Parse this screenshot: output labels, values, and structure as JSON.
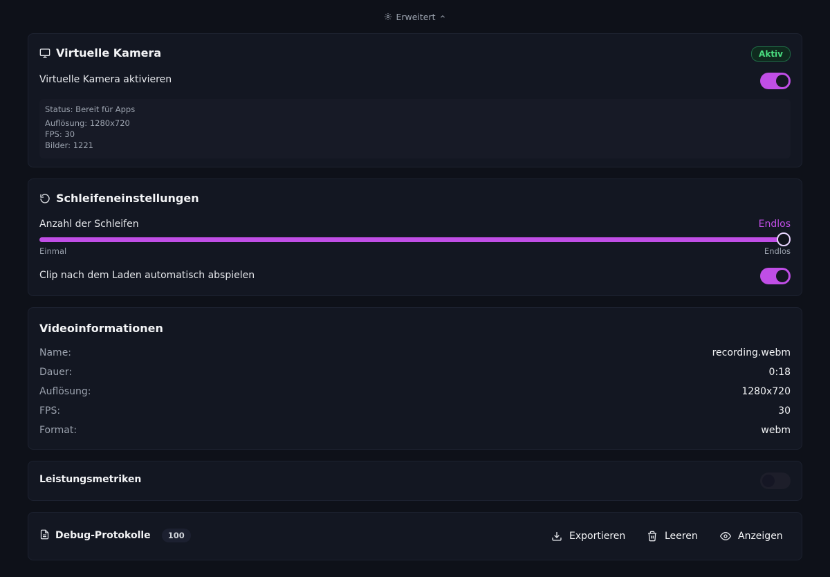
{
  "topbar": {
    "label": "Erweitert"
  },
  "virtual_camera": {
    "title": "Virtuelle Kamera",
    "badge": "Aktiv",
    "enable_label": "Virtuelle Kamera aktivieren",
    "enabled": true,
    "status_lines": {
      "status": "Status: Bereit für Apps",
      "resolution": "Auflösung: 1280x720",
      "fps": "FPS: 30",
      "frames": "Bilder: 1221"
    }
  },
  "loop": {
    "title": "Schleifeneinstellungen",
    "count_label": "Anzahl der Schleifen",
    "count_value": "Endlos",
    "slider_min_label": "Einmal",
    "slider_max_label": "Endlos",
    "slider_fraction": 1.0,
    "autoplay_label": "Clip nach dem Laden automatisch abspielen",
    "autoplay_enabled": true
  },
  "video_info": {
    "title": "Videoinformationen",
    "rows": [
      {
        "key": "Name:",
        "value": "recording.webm"
      },
      {
        "key": "Dauer:",
        "value": "0:18"
      },
      {
        "key": "Auflösung:",
        "value": "1280x720"
      },
      {
        "key": "FPS:",
        "value": "30"
      },
      {
        "key": "Format:",
        "value": "webm"
      }
    ]
  },
  "metrics": {
    "title": "Leistungsmetriken",
    "enabled": false
  },
  "debug": {
    "title": "Debug-Protokolle",
    "count": "100",
    "export_label": "Exportieren",
    "clear_label": "Leeren",
    "show_label": "Anzeigen"
  },
  "colors": {
    "accent": "#c04ee6",
    "active_badge": "#4ade80",
    "background": "#0e1119",
    "card": "#131722"
  }
}
